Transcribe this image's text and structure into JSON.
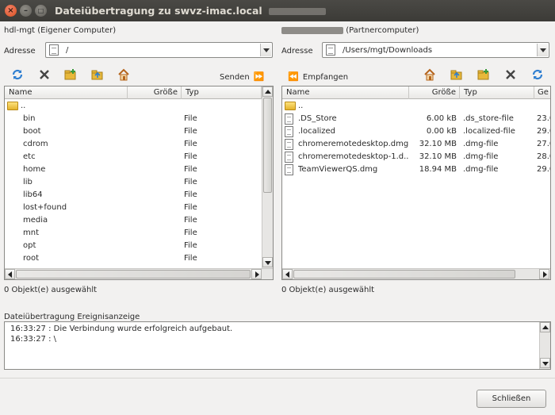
{
  "window": {
    "title": "Dateiübertragung zu swvz-imac.local",
    "controls": {
      "close": "×",
      "minimize": "–",
      "maximize": "□"
    }
  },
  "local": {
    "label": "hdl-mgt (Eigener Computer)",
    "address_label": "Adresse",
    "address": "/",
    "send_label": "Senden",
    "columns": [
      "Name",
      "Größe",
      "Typ"
    ],
    "parent": "..",
    "rows": [
      {
        "name": "bin",
        "size": "",
        "type": "File"
      },
      {
        "name": "boot",
        "size": "",
        "type": "File"
      },
      {
        "name": "cdrom",
        "size": "",
        "type": "File"
      },
      {
        "name": "etc",
        "size": "",
        "type": "File"
      },
      {
        "name": "home",
        "size": "",
        "type": "File"
      },
      {
        "name": "lib",
        "size": "",
        "type": "File"
      },
      {
        "name": "lib64",
        "size": "",
        "type": "File"
      },
      {
        "name": "lost+found",
        "size": "",
        "type": "File"
      },
      {
        "name": "media",
        "size": "",
        "type": "File"
      },
      {
        "name": "mnt",
        "size": "",
        "type": "File"
      },
      {
        "name": "opt",
        "size": "",
        "type": "File"
      },
      {
        "name": "root",
        "size": "",
        "type": "File"
      }
    ],
    "status": "0 Objekt(e) ausgewählt"
  },
  "remote": {
    "label": "(Partnercomputer)",
    "address_label": "Adresse",
    "address": "/Users/mgt/Downloads",
    "receive_label": "Empfangen",
    "columns": [
      "Name",
      "Größe",
      "Typ",
      "Ge"
    ],
    "parent": "..",
    "rows": [
      {
        "name": ".DS_Store",
        "size": "6.00 kB",
        "type": ".ds_store-file",
        "date": "23.0"
      },
      {
        "name": ".localized",
        "size": "0.00 kB",
        "type": ".localized-file",
        "date": "29.0"
      },
      {
        "name": "chromeremotedesktop.dmg",
        "size": "32.10 MB",
        "type": ".dmg-file",
        "date": "27.0"
      },
      {
        "name": "chromeremotedesktop-1.d...",
        "size": "32.10 MB",
        "type": ".dmg-file",
        "date": "28.0"
      },
      {
        "name": "TeamViewerQS.dmg",
        "size": "18.94 MB",
        "type": ".dmg-file",
        "date": "29.0"
      }
    ],
    "status": "0 Objekt(e) ausgewählt"
  },
  "log": {
    "label": "Dateiübertragung Ereignisanzeige",
    "lines": [
      "16:33:27 : Die Verbindung wurde erfolgreich aufgebaut.",
      "16:33:27 : \\"
    ]
  },
  "footer": {
    "close_label": "Schließen"
  },
  "icons": {
    "local_toolbar": [
      "refresh-icon",
      "delete-icon",
      "new-folder-icon",
      "parent-folder-icon",
      "home-icon"
    ],
    "remote_toolbar": [
      "home-icon",
      "parent-folder-icon",
      "new-folder-icon",
      "delete-icon",
      "refresh-icon"
    ]
  },
  "colors": {
    "titlebar": "#3c3b37",
    "accent_refresh": "#2f7fd1",
    "folder": "#e8b83a",
    "home": "#d98a2b"
  }
}
